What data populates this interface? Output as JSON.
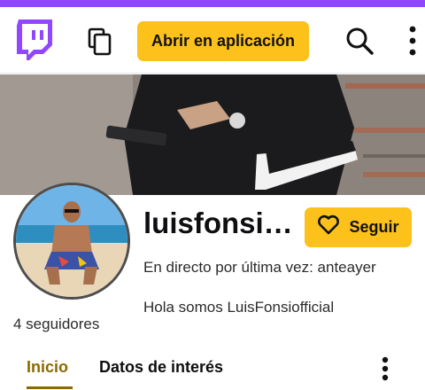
{
  "header": {
    "open_app_label": "Abrir en aplicación",
    "brand_color": "#9147ff",
    "accent_color": "#fcc21b",
    "icons": [
      "twitch-logo-icon",
      "copy-icon",
      "search-icon",
      "more-vertical-icon"
    ]
  },
  "profile": {
    "channel_name": "luisfonsi…",
    "follow_label": "Seguir",
    "last_live": "En directo por última vez: anteayer",
    "bio": "Hola somos LuisFonsiofficial",
    "followers": "4 seguidores"
  },
  "tabs": [
    {
      "label": "Inicio",
      "active": true
    },
    {
      "label": "Datos de interés",
      "active": false
    }
  ]
}
